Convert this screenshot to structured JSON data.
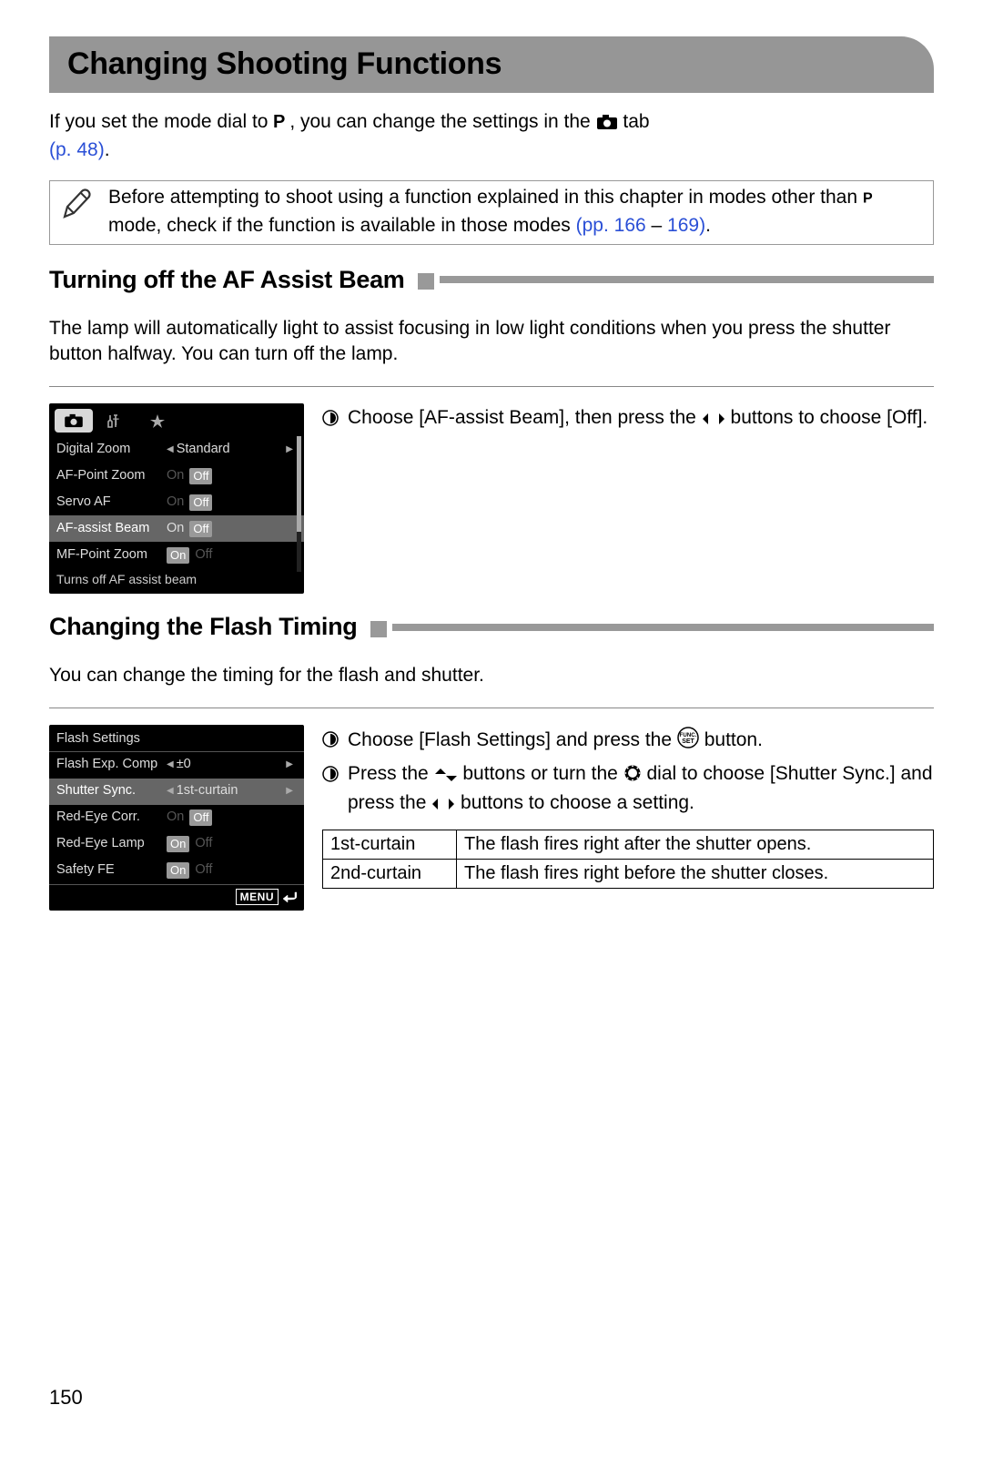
{
  "page_title": "Changing Shooting Functions",
  "intro_pre": "If you set the mode dial to ",
  "intro_mid": ", you can change the settings in the ",
  "intro_post": " tab ",
  "intro_link": "(p. 48)",
  "intro_end": ".",
  "note_pre": "Before attempting to shoot using a function explained in this chapter in modes other than ",
  "note_mid": " mode, check if the function is available in those modes ",
  "note_link1": "(pp. 166",
  "note_dash": " – ",
  "note_link2": "169)",
  "note_end": ".",
  "section1": {
    "heading": "Turning off the AF Assist Beam",
    "body": "The lamp will automatically light to assist focusing in low light conditions when you press the shutter button halfway. You can turn off the lamp.",
    "instruction_pre": "Choose [AF-assist Beam], then press the ",
    "instruction_post": " buttons to choose [Off].",
    "screenshot": {
      "rows": [
        {
          "label": "Digital Zoom",
          "value": "Standard",
          "arrowed": true
        },
        {
          "label": "AF-Point Zoom",
          "on": "On",
          "off": "Off",
          "active": "Off",
          "dimOn": true
        },
        {
          "label": "Servo AF",
          "on": "On",
          "off": "Off",
          "active": "Off",
          "dimOn": true
        },
        {
          "label": "AF-assist Beam",
          "on": "On",
          "off": "Off",
          "active": "Off",
          "highlight": true
        },
        {
          "label": "MF-Point Zoom",
          "on": "On",
          "off": "Off",
          "active": "On",
          "dimOff": true
        }
      ],
      "status": "Turns off AF assist beam"
    }
  },
  "section2": {
    "heading": "Changing the Flash Timing",
    "body": "You can change the timing for the flash and shutter.",
    "instructions": [
      {
        "pre": "Choose [Flash Settings] and press the ",
        "post": " button."
      },
      {
        "pre": "Press the ",
        "mid1": " buttons or turn the ",
        "mid2": " dial to choose [Shutter Sync.] and press the ",
        "post": " buttons to choose a setting."
      }
    ],
    "table": [
      {
        "label": "1st-curtain",
        "desc": "The flash fires right after the shutter opens."
      },
      {
        "label": "2nd-curtain",
        "desc": "The flash fires right before the shutter closes."
      }
    ],
    "screenshot": {
      "title": "Flash Settings",
      "rows": [
        {
          "label": "Flash Exp. Comp",
          "value": "±0",
          "arrowed": true
        },
        {
          "label": "Shutter Sync.",
          "value": "1st-curtain",
          "arrowed": true,
          "highlight": true
        },
        {
          "label": "Red-Eye Corr.",
          "on": "On",
          "off": "Off",
          "active": "Off",
          "dimOn": true
        },
        {
          "label": "Red-Eye Lamp",
          "on": "On",
          "off": "Off",
          "active": "On",
          "dimOff": true
        },
        {
          "label": "Safety FE",
          "on": "On",
          "off": "Off",
          "active": "On",
          "dimOff": true
        }
      ],
      "menu_back": "MENU"
    }
  },
  "page_number": "150"
}
